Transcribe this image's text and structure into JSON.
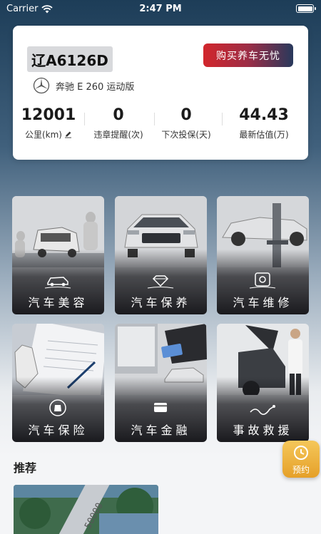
{
  "status_bar": {
    "carrier": "Carrier",
    "time": "2:47 PM"
  },
  "vehicle": {
    "plate": "辽A6126D",
    "model": "奔驰 E 260 运动版",
    "buy_label": "购买养车无忧",
    "stats": [
      {
        "value": "12001",
        "label": "公里(km)"
      },
      {
        "value": "0",
        "label": "违章提醒(次)"
      },
      {
        "value": "0",
        "label": "下次投保(天)"
      },
      {
        "value": "44.43",
        "label": "最新估值(万)"
      }
    ]
  },
  "services": [
    {
      "label": "汽车美容",
      "icon": "car-wash-icon"
    },
    {
      "label": "汽车保养",
      "icon": "diamond-icon"
    },
    {
      "label": "汽车维修",
      "icon": "repair-icon"
    },
    {
      "label": "汽车保险",
      "icon": "shield-car-icon"
    },
    {
      "label": "汽车金融",
      "icon": "card-icon"
    },
    {
      "label": "事故救援",
      "icon": "tow-icon"
    }
  ],
  "recommend": {
    "title": "推荐",
    "banner_text": "50000"
  },
  "booking": {
    "label": "预约"
  },
  "colors": {
    "accent_red": "#d2262c",
    "booking_gold": "#e5a029"
  }
}
